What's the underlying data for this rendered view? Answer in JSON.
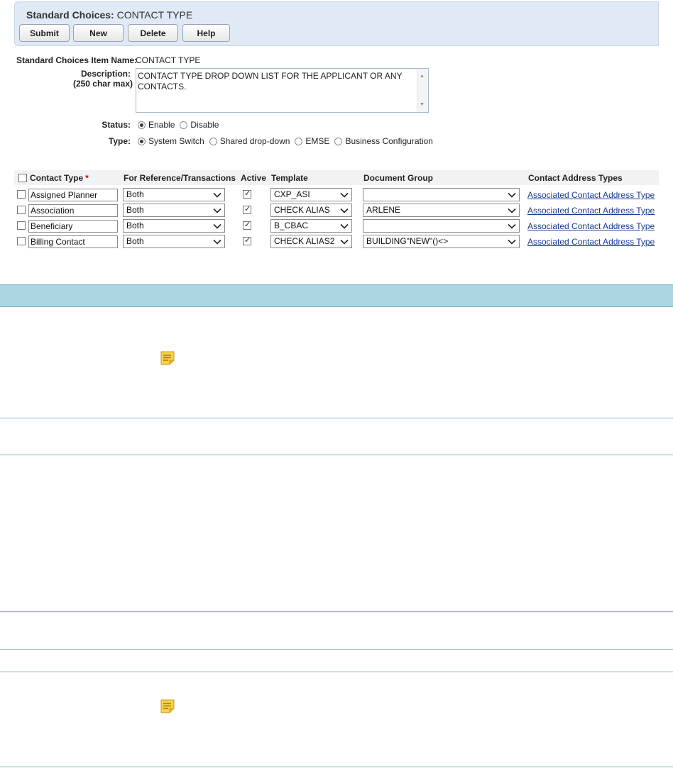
{
  "header": {
    "title_label": "Standard Choices:",
    "title_value": "CONTACT TYPE",
    "buttons": {
      "submit": "Submit",
      "new": "New",
      "delete": "Delete",
      "help": "Help"
    }
  },
  "form": {
    "item_name_label": "Standard Choices Item Name:",
    "item_name_value": "CONTACT TYPE",
    "description_label": "Description:",
    "description_hint": "(250 char max)",
    "description_value": "CONTACT TYPE DROP DOWN LIST FOR THE APPLICANT OR ANY CONTACTS.",
    "status_label": "Status:",
    "status_options": [
      "Enable",
      "Disable"
    ],
    "status_selected": "Enable",
    "type_label": "Type:",
    "type_options": [
      "System Switch",
      "Shared drop-down",
      "EMSE",
      "Business Configuration"
    ],
    "type_selected": "System Switch"
  },
  "table": {
    "columns": [
      "Contact Type",
      "For Reference/Transactions",
      "Active",
      "Template",
      "Document Group",
      "Contact Address Types"
    ],
    "required_mark": "*",
    "rows": [
      {
        "contact_type": "Assigned Planner",
        "reference": "Both",
        "active": true,
        "template": "CXP_ASI",
        "document_group": "",
        "link": "Associated Contact Address Type"
      },
      {
        "contact_type": "Association",
        "reference": "Both",
        "active": true,
        "template": "CHECK ALIAS",
        "document_group": "ARLENE",
        "link": "Associated Contact Address Type"
      },
      {
        "contact_type": "Beneficiary",
        "reference": "Both",
        "active": true,
        "template": "B_CBAC",
        "document_group": "",
        "link": "Associated Contact Address Type"
      },
      {
        "contact_type": "Billing Contact",
        "reference": "Both",
        "active": true,
        "template": "CHECK ALIAS2",
        "document_group": "BUILDING\"NEW\"()<>",
        "link": "Associated Contact Address Type"
      }
    ]
  },
  "icons": {
    "note": "note-icon",
    "select_arrow": "chevron-down-icon"
  },
  "colors": {
    "header_bg": "#dfeaf6",
    "band_bg": "#acd6e2",
    "link": "#1a3c8c",
    "required": "#d00000"
  }
}
